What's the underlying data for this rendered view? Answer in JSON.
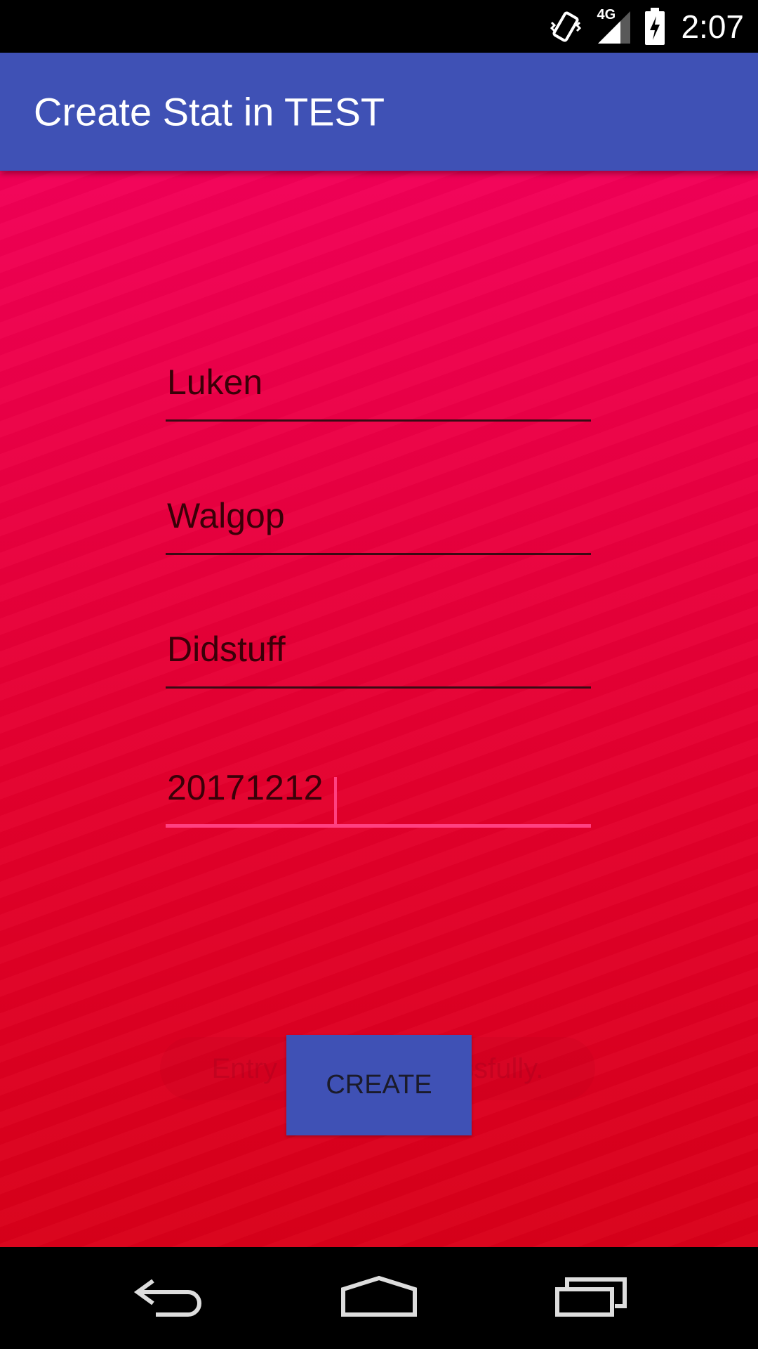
{
  "status_bar": {
    "time": "2:07",
    "network_label": "4G",
    "icons": [
      "vibrate-icon",
      "signal-4g-icon",
      "battery-charging-icon"
    ]
  },
  "app_bar": {
    "title": "Create Stat in TEST",
    "color": "#3f51b5"
  },
  "form": {
    "fields": [
      {
        "value": "Luken"
      },
      {
        "value": "Walgop"
      },
      {
        "value": "Didstuff"
      },
      {
        "value": "20171212"
      }
    ],
    "accent_color": "#ff4081"
  },
  "toast": {
    "message": "Entry created successfully."
  },
  "actions": {
    "create_label": "CREATE"
  },
  "nav_bar": {
    "icons": [
      "back-icon",
      "home-icon",
      "recents-icon"
    ]
  }
}
